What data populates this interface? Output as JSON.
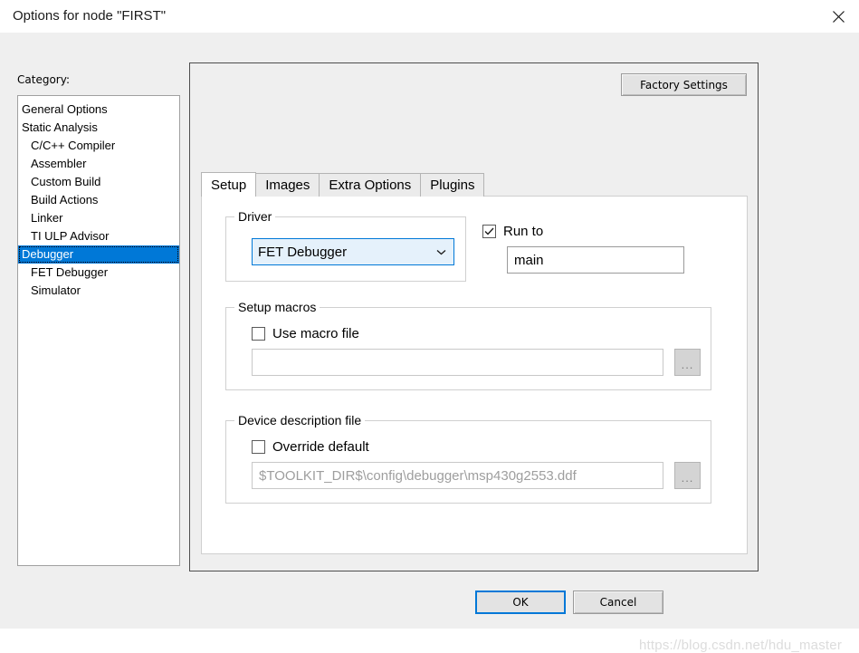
{
  "window": {
    "title": "Options for node \"FIRST\"",
    "close_icon": "close-icon"
  },
  "category": {
    "label": "Category:",
    "items": [
      {
        "label": "General Options",
        "indent": false,
        "selected": false
      },
      {
        "label": "Static Analysis",
        "indent": false,
        "selected": false
      },
      {
        "label": "C/C++ Compiler",
        "indent": true,
        "selected": false
      },
      {
        "label": "Assembler",
        "indent": true,
        "selected": false
      },
      {
        "label": "Custom Build",
        "indent": true,
        "selected": false
      },
      {
        "label": "Build Actions",
        "indent": true,
        "selected": false
      },
      {
        "label": "Linker",
        "indent": true,
        "selected": false
      },
      {
        "label": "TI ULP Advisor",
        "indent": true,
        "selected": false
      },
      {
        "label": "Debugger",
        "indent": true,
        "selected": true
      },
      {
        "label": "FET Debugger",
        "indent": true,
        "selected": false
      },
      {
        "label": "Simulator",
        "indent": true,
        "selected": false
      }
    ]
  },
  "panel": {
    "factory_settings_label": "Factory Settings",
    "tabs": [
      {
        "label": "Setup",
        "active": true
      },
      {
        "label": "Images",
        "active": false
      },
      {
        "label": "Extra Options",
        "active": false
      },
      {
        "label": "Plugins",
        "active": false
      }
    ]
  },
  "setup": {
    "driver": {
      "group_title": "Driver",
      "selected_value": "FET Debugger",
      "chevron_icon": "chevron-down-icon"
    },
    "run_to": {
      "label": "Run to",
      "checked": true,
      "value": "main"
    },
    "setup_macros": {
      "group_title": "Setup macros",
      "checkbox_label": "Use macro file",
      "checked": false,
      "path_value": "",
      "browse_label": "..."
    },
    "device_description": {
      "group_title": "Device description file",
      "checkbox_label": "Override default",
      "checked": false,
      "path_value": "$TOOLKIT_DIR$\\config\\debugger\\msp430g2553.ddf",
      "browse_label": "..."
    }
  },
  "footer": {
    "ok_label": "OK",
    "cancel_label": "Cancel"
  },
  "watermark": {
    "text": "https://blog.csdn.net/hdu_master"
  },
  "colors": {
    "accent": "#0078d7",
    "selection_bg": "#0078d7",
    "combo_bg": "#e5f1fb",
    "dialog_bg": "#efefef",
    "disabled_text": "#9e9e9e"
  }
}
